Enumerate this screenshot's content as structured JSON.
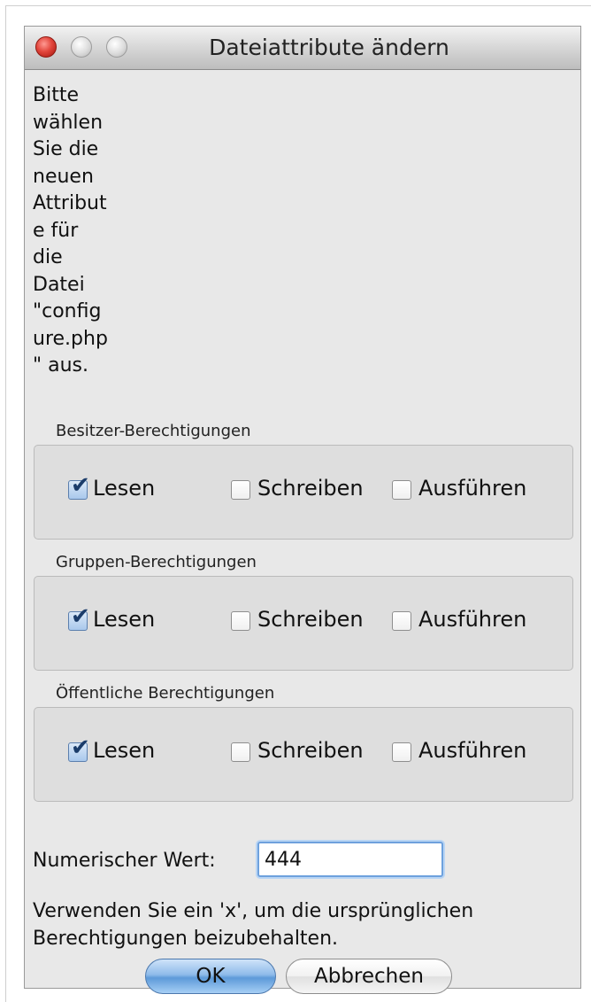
{
  "window": {
    "title": "Dateiattribute ändern"
  },
  "message_lines": [
    "Bitte",
    "wählen",
    "Sie die",
    "neuen",
    "Attribut",
    "e für",
    "die",
    "Datei",
    "\"config",
    "ure.php",
    "\" aus."
  ],
  "groups": [
    {
      "label": "Besitzer-Berechtigungen",
      "read": {
        "label": "Lesen",
        "checked": true
      },
      "write": {
        "label": "Schreiben",
        "checked": false
      },
      "exec": {
        "label": "Ausführen",
        "checked": false
      }
    },
    {
      "label": "Gruppen-Berechtigungen",
      "read": {
        "label": "Lesen",
        "checked": true
      },
      "write": {
        "label": "Schreiben",
        "checked": false
      },
      "exec": {
        "label": "Ausführen",
        "checked": false
      }
    },
    {
      "label": "Öffentliche Berechtigungen",
      "read": {
        "label": "Lesen",
        "checked": true
      },
      "write": {
        "label": "Schreiben",
        "checked": false
      },
      "exec": {
        "label": "Ausführen",
        "checked": false
      }
    }
  ],
  "numeric": {
    "label": "Numerischer Wert:",
    "value": "444"
  },
  "hint": "Verwenden Sie ein 'x', um die ursprünglichen Berechtigungen beizubehalten.",
  "buttons": {
    "ok": "OK",
    "cancel": "Abbrechen"
  },
  "colors": {
    "accent": "#5d9ad9",
    "checked_mark": "#1b3c6a",
    "close_button": "#e2463c"
  }
}
